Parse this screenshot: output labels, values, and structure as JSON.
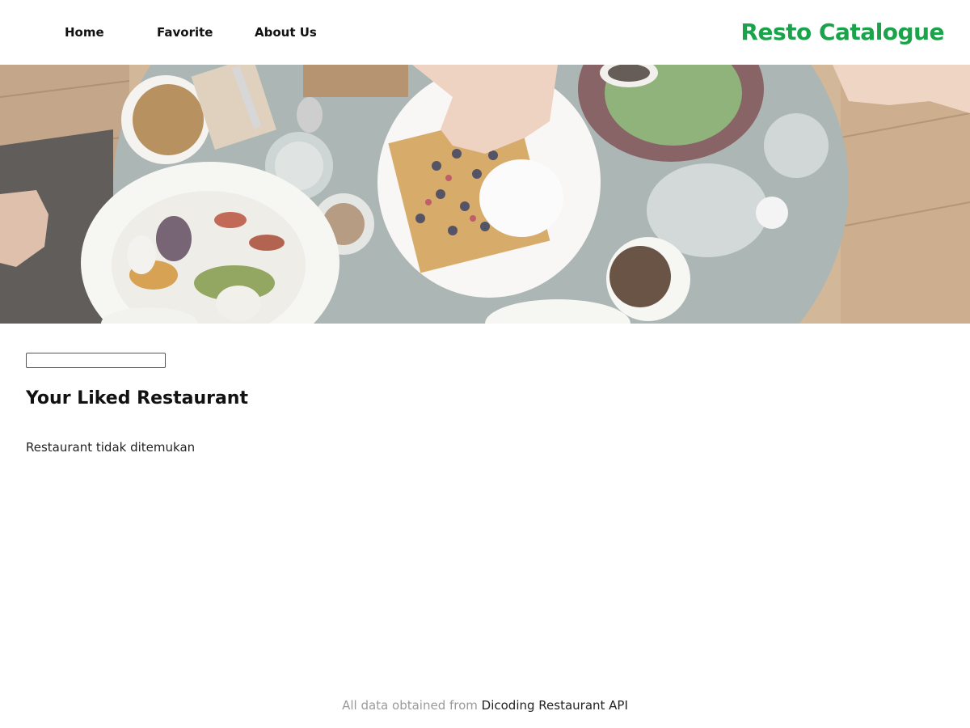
{
  "nav": {
    "items": [
      {
        "label": "Home"
      },
      {
        "label": "Favorite"
      },
      {
        "label": "About Us"
      }
    ],
    "brand": "Resto Catalogue"
  },
  "hero": {
    "image": "restaurant-table-food-photo"
  },
  "search": {
    "value": "",
    "placeholder": ""
  },
  "main": {
    "title": "Your Liked Restaurant",
    "empty_message": "Restaurant tidak ditemukan"
  },
  "footer": {
    "prefix": "All data obtained from",
    "link_text": "Dicoding Restaurant API"
  },
  "colors": {
    "brand": "#1aa34a",
    "text": "#111111",
    "muted": "#9a9a9a"
  }
}
